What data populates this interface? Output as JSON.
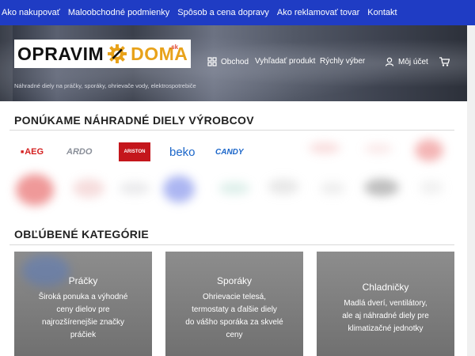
{
  "topnav": {
    "items": [
      "Ako nakupovať",
      "Maloobchodné podmienky",
      "Spôsob a cena dopravy",
      "Ako reklamovať tovar",
      "Kontakt"
    ]
  },
  "header": {
    "logo_part1": "OPRAVIM",
    "logo_part2": "DOMA",
    "logo_suffix": ".sk",
    "tagline": "Náhradné diely na práčky, sporáky, ohrievače vody, elektrospotrebiče",
    "nav": {
      "shop": "Obchod",
      "search": "Vyhľadať produkt",
      "quick": "Rýchly výber",
      "account": "Môj účet"
    }
  },
  "brands_section": {
    "title": "PONÚKAME NÁHRADNÉ DIELY VÝROBCOV",
    "brands": [
      "AEG",
      "ARDO",
      "ARISTON",
      "beko",
      "CANDY"
    ]
  },
  "categories_section": {
    "title": "OBĽÚBENÉ KATEGÓRIE",
    "cards": [
      {
        "title": "Práčky",
        "desc_lines": [
          "Široká ponuka a výhodné",
          "ceny dielov pre",
          "najrozšírenejšie značky",
          "práčiek"
        ]
      },
      {
        "title": "Sporáky",
        "desc_lines": [
          "Ohrievacie telesá,",
          "termostaty a ďalšie diely",
          "do vášho sporáka za skvelé",
          "ceny"
        ]
      },
      {
        "title": "Chladničky",
        "desc_lines": [
          "Madlá dverí, ventilátory,",
          "ale aj náhradné diely pre",
          "klimatizačné jednotky"
        ]
      }
    ]
  },
  "colors": {
    "topnav_bg": "#1f3cc4",
    "accent_orange": "#e8a21a",
    "aeg_red": "#d42020",
    "beko_blue": "#1b66c9",
    "candy_blue": "#1b66c9"
  }
}
